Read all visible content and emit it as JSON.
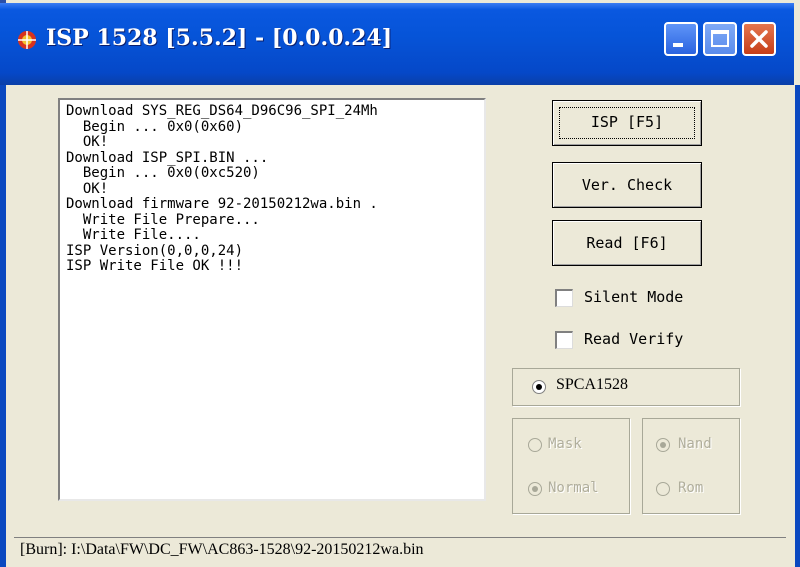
{
  "window": {
    "title": "ISP 1528 [5.5.2] - [0.0.0.24]",
    "title_bar_color": "#0654d8",
    "close_button_color": "#c53d18"
  },
  "log": {
    "lines": [
      "Download SYS_REG_DS64_D96C96_SPI_24Mh",
      "  Begin ... 0x0(0x60)",
      "  OK!",
      "Download ISP_SPI.BIN ...",
      "  Begin ... 0x0(0xc520)",
      "  OK!",
      "Download firmware 92-20150212wa.bin .",
      "  Write File Prepare...",
      "  Write File....",
      "ISP Version(0,0,0,24)",
      "ISP Write File OK !!!"
    ]
  },
  "buttons": {
    "isp": "ISP [F5]",
    "ver_check": "Ver. Check",
    "read": "Read [F6]"
  },
  "options": {
    "silent_mode": {
      "label": "Silent Mode",
      "checked": false
    },
    "read_verify": {
      "label": "Read Verify",
      "checked": false
    }
  },
  "chip": {
    "label": "SPCA1528",
    "selected": true
  },
  "mode_group": {
    "mask": {
      "label": "Mask",
      "selected": false,
      "enabled": false
    },
    "normal": {
      "label": "Normal",
      "selected": true,
      "enabled": false
    }
  },
  "storage_group": {
    "nand": {
      "label": "Nand",
      "selected": true,
      "enabled": false
    },
    "rom": {
      "label": "Rom",
      "selected": false,
      "enabled": false
    }
  },
  "status": {
    "text": "[Burn]: I:\\Data\\FW\\DC_FW\\AC863-1528\\92-20150212wa.bin"
  }
}
